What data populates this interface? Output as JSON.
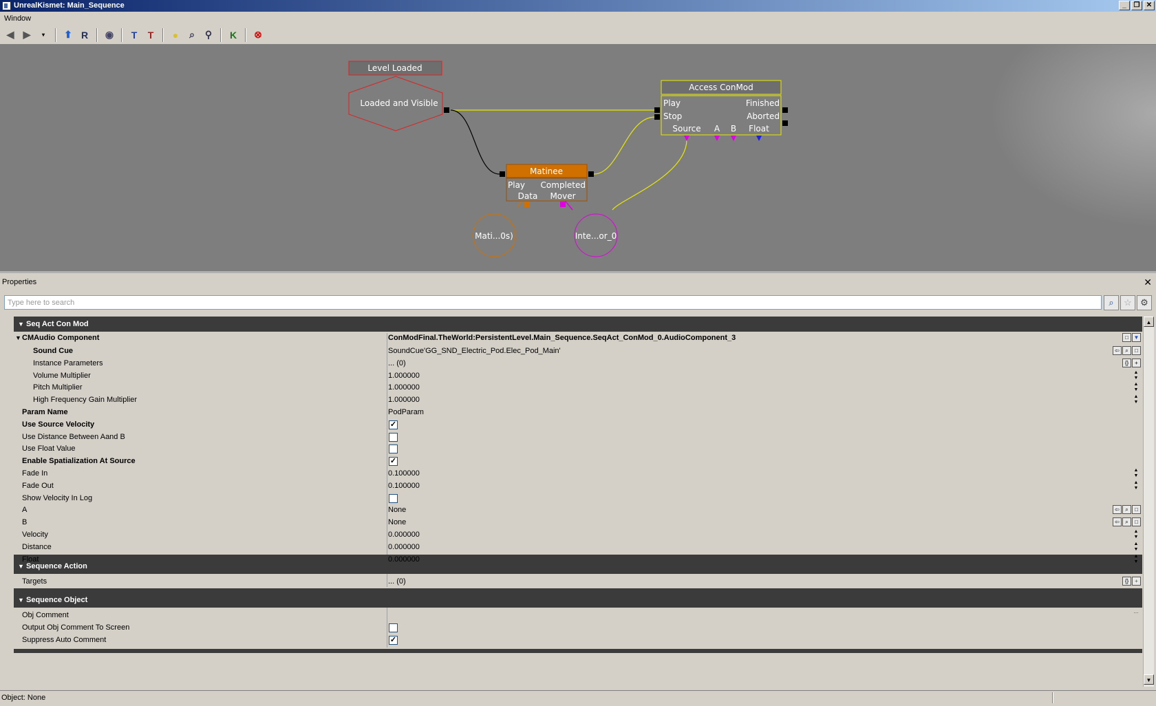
{
  "window": {
    "title": "UnrealKismet: Main_Sequence"
  },
  "menu": {
    "window": "Window"
  },
  "graph": {
    "level_loaded_title": "Level Loaded",
    "level_loaded_output": "Loaded and Visible",
    "access_title": "Access ConMod",
    "access_in_play": "Play",
    "access_in_stop": "Stop",
    "access_out_finished": "Finished",
    "access_out_aborted": "Aborted",
    "access_var_source": "Source",
    "access_var_a": "A",
    "access_var_b": "B",
    "access_var_float": "Float",
    "matinee_title": "Matinee",
    "matinee_in_play": "Play",
    "matinee_out_completed": "Completed",
    "matinee_var_data": "Data",
    "matinee_var_mover": "Mover",
    "var_matinee": "Mati...0s)",
    "var_interp": "Inte...or_0"
  },
  "properties": {
    "label": "Properties",
    "search_placeholder": "Type here to search",
    "cat1": "Seq Act Con Mod",
    "component_name": "CMAudio Component",
    "component_value": "ConModFinal.TheWorld:PersistentLevel.Main_Sequence.SeqAct_ConMod_0.AudioComponent_3",
    "rows": [
      {
        "name": "Sound Cue",
        "value": "SoundCue'GG_SND_Electric_Pod.Elec_Pod_Main'"
      },
      {
        "name": "Instance Parameters",
        "value": "... (0)"
      },
      {
        "name": "Volume Multiplier",
        "value": "1.000000"
      },
      {
        "name": "Pitch Multiplier",
        "value": "1.000000"
      },
      {
        "name": "High Frequency Gain Multiplier",
        "value": "1.000000"
      },
      {
        "name": "Param Name",
        "value": "PodParam"
      },
      {
        "name": "Use Source Velocity",
        "checked": true
      },
      {
        "name": "Use Distance Between Aand B",
        "checked": false
      },
      {
        "name": "Use Float Value",
        "checked": false
      },
      {
        "name": "Enable Spatialization At Source",
        "checked": true
      },
      {
        "name": "Fade In",
        "value": "0.100000"
      },
      {
        "name": "Fade Out",
        "value": "0.100000"
      },
      {
        "name": "Show Velocity In Log",
        "checked": false
      },
      {
        "name": "A",
        "value": "None"
      },
      {
        "name": "B",
        "value": "None"
      },
      {
        "name": "Velocity",
        "value": "0.000000"
      },
      {
        "name": "Distance",
        "value": "0.000000"
      },
      {
        "name": "Float",
        "value": "0.000000"
      }
    ],
    "cat2": "Sequence Action",
    "targets_name": "Targets",
    "targets_value": "... (0)",
    "cat3": "Sequence Object",
    "obj_rows": [
      {
        "name": "Obj Comment",
        "value": ""
      },
      {
        "name": "Output Obj Comment To Screen",
        "checked": false
      },
      {
        "name": "Suppress Auto Comment",
        "checked": true
      }
    ]
  },
  "status": {
    "text": "Object: None"
  },
  "colors": {
    "event_red": "#e02020",
    "action_yellow": "#e8e800",
    "matinee_orange": "#d07000",
    "var_magenta": "#e000e0",
    "var_blue": "#2020e0"
  }
}
